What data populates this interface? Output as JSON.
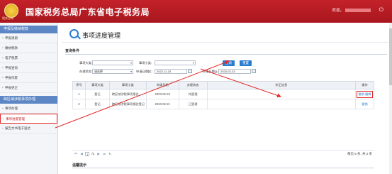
{
  "header": {
    "title": "国家税务总局广东省电子税务局",
    "emblem_text": "税务总局",
    "user_label": "欢迎，"
  },
  "sidebar": {
    "groups": [
      {
        "title": "申报及缴纳税款",
        "items": [
          "申报清册",
          "缴纳税款",
          "电子税票",
          "申报查询",
          "申报作废",
          "申报更正"
        ]
      },
      {
        "title": "跨区域涉税事项办理",
        "items": [
          "事项办理",
          "事项进度管理",
          "报告文书电子送达"
        ]
      }
    ],
    "active_item": "事项进度管理"
  },
  "main": {
    "page_title": "事项进度管理",
    "query_section": "查询条件",
    "filters": {
      "category_label": "事项大类：",
      "category_value": "",
      "subcategory_label": "事项小类：",
      "subcategory_value": "",
      "status_label": "办理状态：",
      "status_value": "请选择",
      "apply_start_label": "申请日期起：",
      "apply_start_value": "2022-11-24",
      "apply_end_label": "申请日期止：",
      "apply_end_value": "2023-02-23"
    },
    "buttons": {
      "query": "查询",
      "reset": "重置"
    },
    "table": {
      "columns": [
        "序号",
        "事项大类",
        "事项小类",
        "申请日期",
        "办理状态",
        "补正信息",
        "操作"
      ],
      "rows": [
        {
          "no": "1",
          "category": "登记",
          "subcategory": "跨区域涉税事项报告",
          "date": "2023-02-22",
          "status": "待受理",
          "info": "",
          "ops": [
            "撤销",
            "编辑"
          ]
        },
        {
          "no": "2",
          "category": "登记",
          "subcategory": "跨区域涉税事项报验登记",
          "date": "2023-02-21",
          "status": "已受理",
          "info": "",
          "ops": [
            "撤销"
          ]
        }
      ]
    },
    "pager": {
      "page": "1",
      "of_label": "/1",
      "total": "每页 5 条, 共 2 条"
    },
    "bottom_section": "温馨提示"
  },
  "colors": {
    "header_red": "#c4222a",
    "accent_blue": "#2a7bd0",
    "highlight_red": "#e12a2a"
  }
}
